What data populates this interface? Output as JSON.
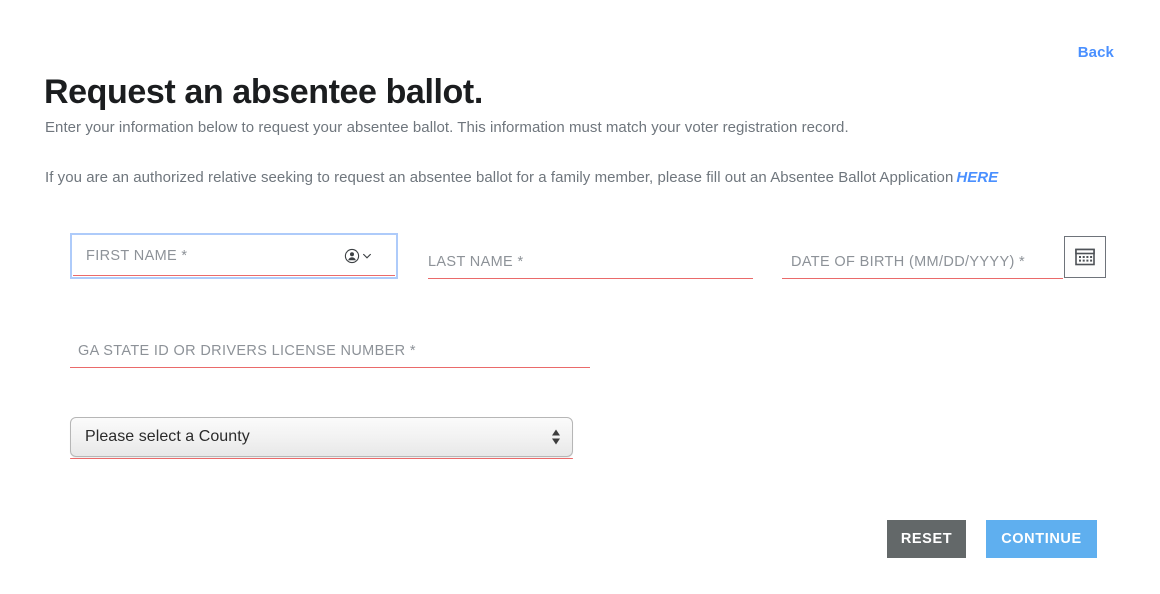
{
  "header": {
    "back_label": "Back"
  },
  "page": {
    "title": "Request an absentee ballot.",
    "intro_line_1": "Enter your information below to request your absentee ballot. This information must match your voter registration record.",
    "intro_line_2": "If you are an authorized relative seeking to request an absentee ballot for a family member, please fill out an Absentee Ballot Application",
    "intro_link_label": "HERE"
  },
  "form": {
    "fields": [
      {
        "name": "first-name",
        "label": "FIRST NAME *",
        "value": "",
        "required": true,
        "focused": true
      },
      {
        "name": "last-name",
        "label": "LAST NAME *",
        "value": "",
        "required": true,
        "focused": false
      },
      {
        "name": "date-of-birth",
        "label": "DATE OF BIRTH (MM/DD/YYYY) *",
        "value": "",
        "required": true,
        "focused": false
      },
      {
        "name": "state-id",
        "label": "GA STATE ID OR DRIVERS LICENSE NUMBER *",
        "value": "",
        "required": true,
        "focused": false
      }
    ],
    "county_select": {
      "selected": "Please select a County"
    },
    "icons": {
      "autofill": "contact-autofill-icon",
      "calendar": "calendar-icon"
    }
  },
  "actions": {
    "reset_label": "RESET",
    "continue_label": "CONTINUE"
  },
  "colors": {
    "link": "#4a90ff",
    "required_underline": "#ea6a6a",
    "focus_ring": "#aecbfa",
    "reset_button": "#636869",
    "continue_button": "#5fafef",
    "title_text": "#1b1d1f",
    "body_text": "#6f767d",
    "placeholder_text": "#8d9298"
  }
}
